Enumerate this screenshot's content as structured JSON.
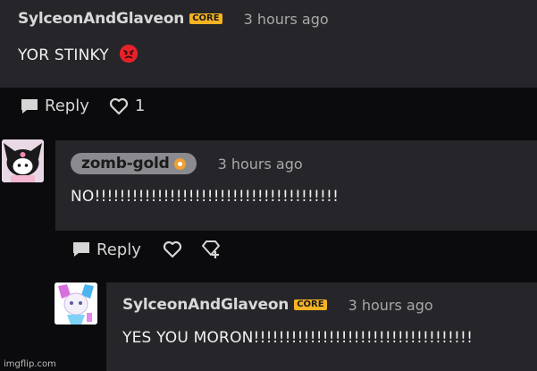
{
  "comments": [
    {
      "author": "SylceonAndGlaveon",
      "badge": "CORE",
      "time": "3 hours ago",
      "text": "YOR STINKY",
      "emoji": "angry-face-icon"
    },
    {
      "author": "zomb-gold",
      "badge_icon": "gold-star-badge-icon",
      "time": "3 hours ago",
      "text": "NO!!!!!!!!!!!!!!!!!!!!!!!!!!!!!!!!!!!!!!!"
    },
    {
      "author": "SylceonAndGlaveon",
      "badge": "CORE",
      "time": "3 hours ago",
      "text": "YES YOU MORON!!!!!!!!!!!!!!!!!!!!!!!!!!!!!!!!!!!"
    }
  ],
  "actions": {
    "reply_label": "Reply",
    "like_count_1": "1"
  },
  "watermark": "imgflip.com",
  "colors": {
    "background": "#0b0b0d",
    "card": "#26262a",
    "core_badge": "#f5b323",
    "user_pill": "#8a8a8f"
  }
}
